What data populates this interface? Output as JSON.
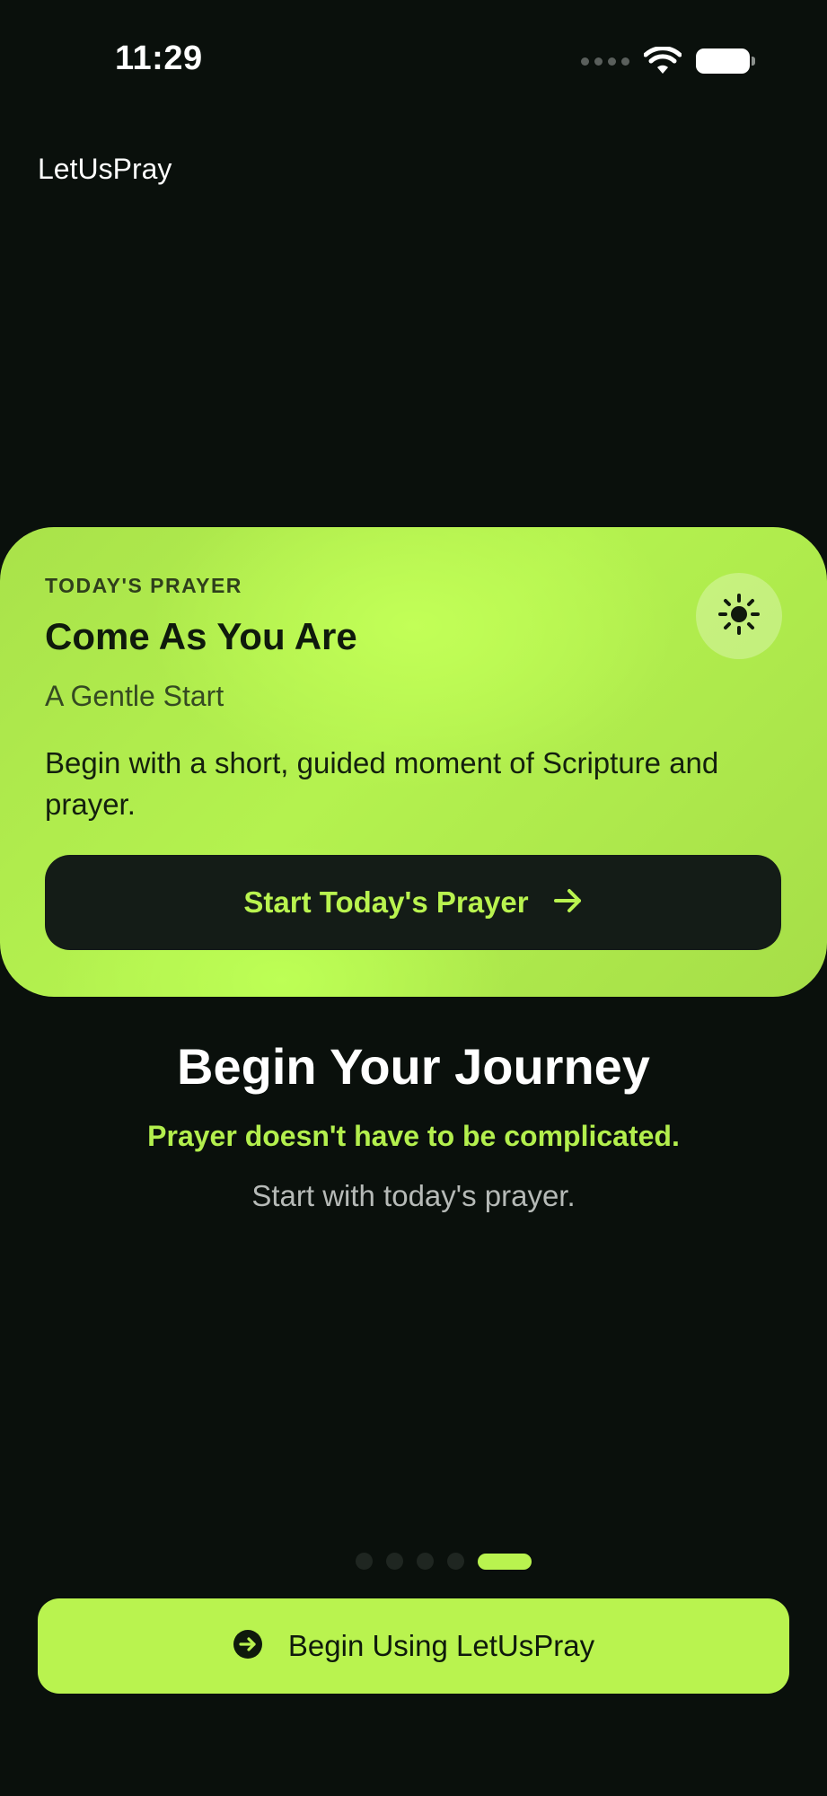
{
  "status_bar": {
    "time": "11:29",
    "icons": [
      "cellular-signal-icon",
      "wifi-icon",
      "battery-icon"
    ]
  },
  "app": {
    "title": "LetUsPray"
  },
  "prayer_card": {
    "eyebrow": "TODAY'S PRAYER",
    "title": "Come As You Are",
    "subtitle": "A Gentle Start",
    "description": "Begin with a short, guided moment of Scripture and prayer.",
    "icon": "sun-icon",
    "start_button_label": "Start Today's Prayer",
    "start_button_icon": "arrow-right-icon"
  },
  "intro": {
    "headline": "Begin Your Journey",
    "tagline": "Prayer doesn't have to be complicated.",
    "subtext": "Start with today's prayer."
  },
  "pager": {
    "page_count": 5,
    "current_page": 5
  },
  "cta": {
    "label": "Begin Using LetUsPray",
    "icon": "arrow-circle-right-icon"
  },
  "colors": {
    "background": "#0a100c",
    "accent": "#b9f34f",
    "button_dark": "#141c17",
    "text_primary": "#ffffff",
    "text_secondary": "#b6bab7"
  }
}
